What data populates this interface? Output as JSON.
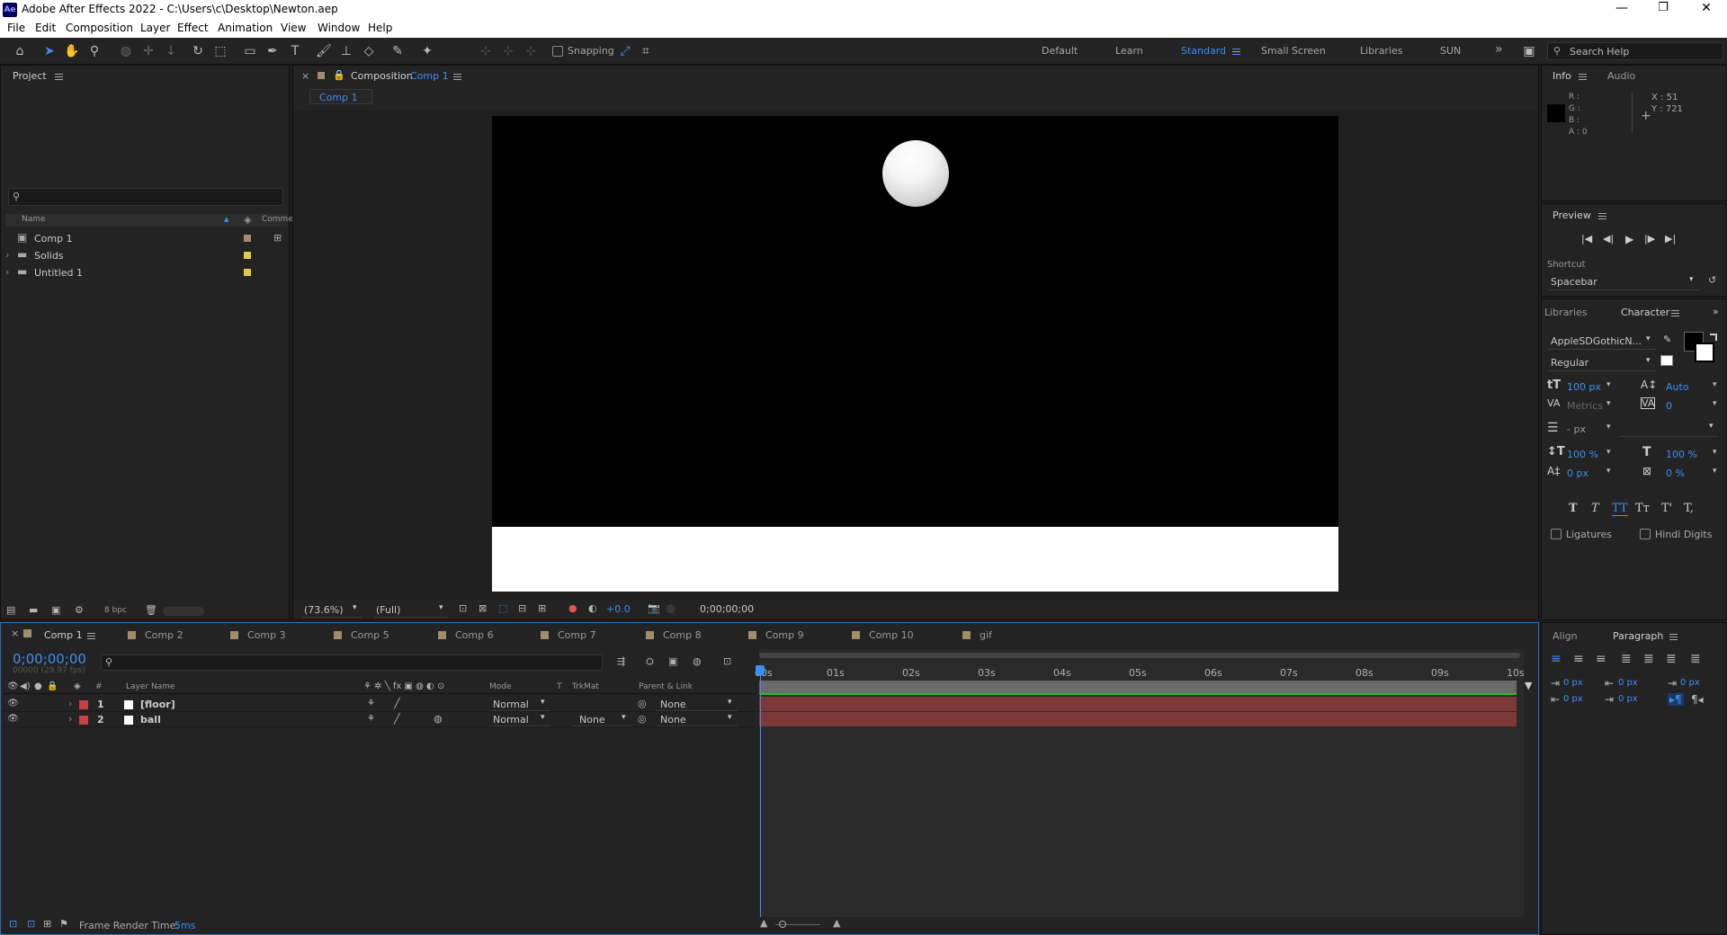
{
  "app": {
    "title": "Adobe After Effects 2022 - C:\\Users\\c\\Desktop\\Newton.aep",
    "logo": "Ae",
    "window_controls": {
      "minimize": "—",
      "maximize": "❐",
      "close": "✕"
    }
  },
  "menu": [
    "File",
    "Edit",
    "Composition",
    "Layer",
    "Effect",
    "Animation",
    "View",
    "Window",
    "Help"
  ],
  "toolbar": {
    "snapping_label": "Snapping",
    "workspaces": [
      "Default",
      "Learn",
      "Standard",
      "Small Screen",
      "Libraries",
      "SUN"
    ],
    "active_workspace": "Standard",
    "overflow": "»",
    "search_placeholder": "Search Help"
  },
  "project": {
    "title": "Project",
    "columns": {
      "name": "Name",
      "comment": "Comme"
    },
    "items": [
      {
        "name": "Comp 1",
        "type": "composition",
        "label_color": "#a38c6b"
      },
      {
        "name": "Solids",
        "type": "folder",
        "label_color": "#e2c948"
      },
      {
        "name": "Untitled 1",
        "type": "folder",
        "label_color": "#e2c948"
      }
    ],
    "bpc": "8 bpc"
  },
  "composition": {
    "panel_label": "Composition",
    "comp_name": "Comp 1",
    "tab": "Comp 1",
    "zoom": "(73.6%)",
    "resolution": "(Full)",
    "exposure": "+0.0",
    "timecode": "0;00;00;00",
    "canvas_bg": "#000000",
    "floor_color": "#ffffff"
  },
  "info": {
    "tabs": [
      "Info",
      "Audio"
    ],
    "r": "R :",
    "g": "G :",
    "b": "B :",
    "a": "A : 0",
    "x": "X : 51",
    "y": "Y : 721",
    "crosshair": "+"
  },
  "preview": {
    "title": "Preview",
    "shortcut_label": "Shortcut",
    "shortcut_value": "Spacebar",
    "controls": [
      "⏮",
      "◀|",
      "▶",
      "|▶",
      "⏭"
    ]
  },
  "character": {
    "tabs": [
      "Libraries",
      "Character"
    ],
    "font": "AppleSDGothicN...",
    "style": "Regular",
    "size": "100 px",
    "leading": "Auto",
    "kerning": "Metrics",
    "tracking": "0",
    "stroke": "- px",
    "vscale": "100 %",
    "hscale": "100 %",
    "baseline": "0 px",
    "tsume": "0 %",
    "styles": [
      "T",
      "T",
      "TT",
      "Tт",
      "T'",
      "T,"
    ],
    "ligatures": "Ligatures",
    "hindi": "Hindi Digits"
  },
  "paragraph": {
    "tabs": [
      "Align",
      "Paragraph"
    ],
    "indent_values": [
      "0 px",
      "0 px",
      "0 px",
      "0 px",
      "0 px"
    ]
  },
  "timeline": {
    "tabs": [
      "Comp 1",
      "Comp 2",
      "Comp 3",
      "Comp 5",
      "Comp 6",
      "Comp 7",
      "Comp 8",
      "Comp 9",
      "Comp 10",
      "gif"
    ],
    "timecode": "0;00;00;00",
    "fps": "00000 (29.97 fps)",
    "columns": {
      "num": "#",
      "layer_name": "Layer Name",
      "mode": "Mode",
      "t": "T",
      "trkmat": "TrkMat",
      "parent": "Parent & Link"
    },
    "layers": [
      {
        "num": "1",
        "name": "[floor]",
        "label_color": "#c94040",
        "mode": "Normal",
        "trkmat": "",
        "parent": "None"
      },
      {
        "num": "2",
        "name": "ball",
        "label_color": "#c94040",
        "mode": "Normal",
        "trkmat": "None",
        "parent": "None"
      }
    ],
    "ruler": [
      "00s",
      "01s",
      "02s",
      "03s",
      "04s",
      "05s",
      "06s",
      "07s",
      "08s",
      "09s",
      "10s"
    ],
    "footer": {
      "label": "Frame Render Time:",
      "value": "5ms"
    }
  }
}
